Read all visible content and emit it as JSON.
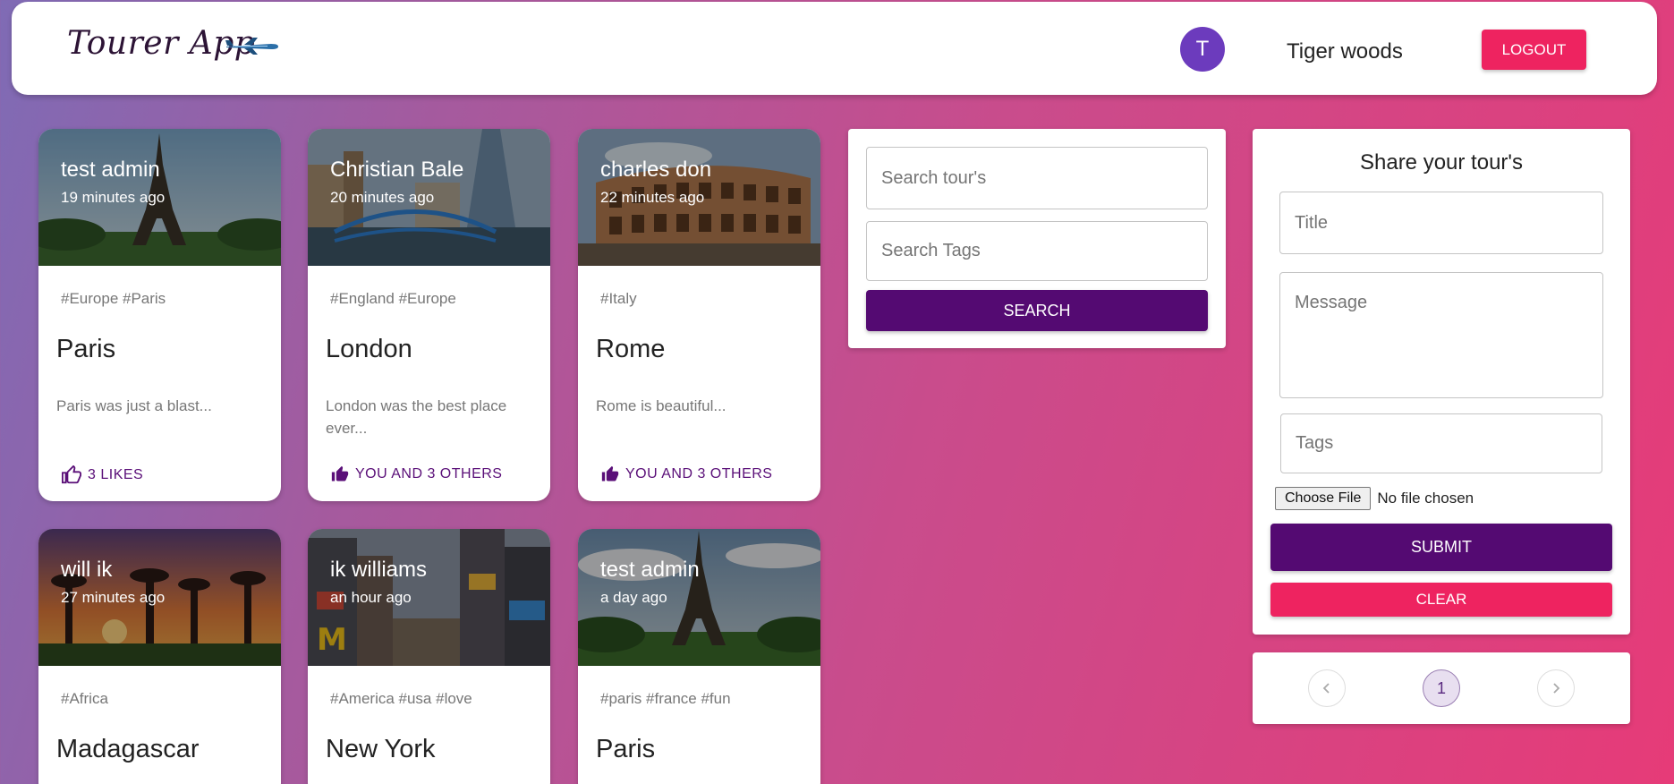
{
  "header": {
    "brand": "Tourer App",
    "avatar_letter": "T",
    "user_name": "Tiger woods",
    "logout_label": "LOGOUT"
  },
  "cards": [
    {
      "author": "test admin",
      "time": "19 minutes ago",
      "tags": "#Europe #Paris",
      "title": "Paris",
      "message": "Paris was just a blast...",
      "likes": "3 LIKES"
    },
    {
      "author": "Christian Bale",
      "time": "20 minutes ago",
      "tags": "#England #Europe",
      "title": "London",
      "message": "London was the best place ever...",
      "likes": "YOU AND 3 OTHERS"
    },
    {
      "author": "charles don",
      "time": "22 minutes ago",
      "tags": "#Italy",
      "title": "Rome",
      "message": "Rome is beautiful...",
      "likes": "YOU AND 3 OTHERS"
    },
    {
      "author": "will ik",
      "time": "27 minutes ago",
      "tags": "#Africa",
      "title": "Madagascar"
    },
    {
      "author": "ik williams",
      "time": "an hour ago",
      "tags": "#America #usa #love",
      "title": "New York"
    },
    {
      "author": "test admin",
      "time": "a day ago",
      "tags": "#paris #france #fun",
      "title": "Paris"
    }
  ],
  "search": {
    "tours_placeholder": "Search tour's",
    "tags_placeholder": "Search Tags",
    "button_label": "SEARCH"
  },
  "form": {
    "heading": "Share your tour's",
    "title_placeholder": "Title",
    "message_placeholder": "Message",
    "tags_placeholder": "Tags",
    "file_button": "Choose File",
    "file_status": "No file chosen",
    "submit_label": "SUBMIT",
    "clear_label": "CLEAR"
  },
  "pagination": {
    "prev_icon": "chevron-left-icon",
    "current_page": "1",
    "next_icon": "chevron-right-icon"
  },
  "colors": {
    "primary": "#540a72",
    "secondary": "#ee2360",
    "avatar": "#6c3bbd"
  }
}
